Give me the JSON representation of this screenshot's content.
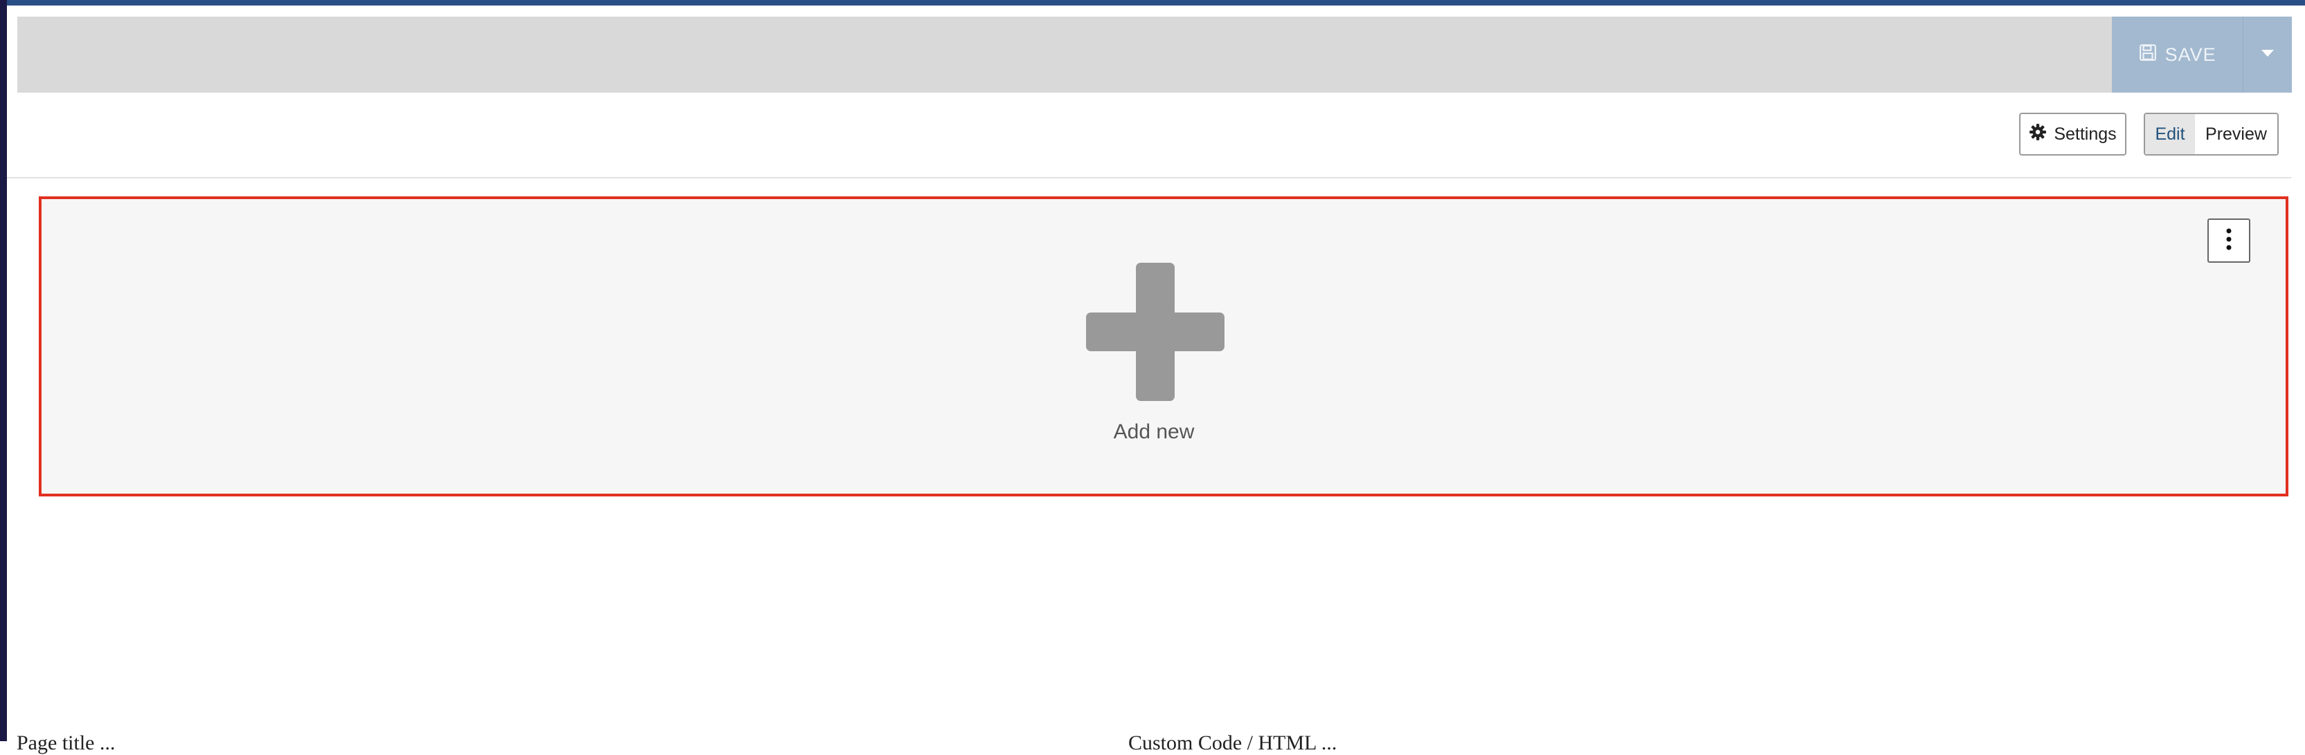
{
  "toolbar": {
    "save_label": "SAVE",
    "save_icon": "floppy-disk-icon",
    "dropdown_icon": "caret-down-icon"
  },
  "controls": {
    "settings_label": "Settings",
    "settings_icon": "gear-icon",
    "edit_label": "Edit",
    "preview_label": "Preview",
    "active_mode": "Edit"
  },
  "block": {
    "add_new_label": "Add new",
    "add_icon": "plus-icon",
    "menu_icon": "vertical-dots-icon"
  },
  "footer": {
    "left_text": "Page title ...",
    "right_text": "Custom Code / HTML ..."
  },
  "colors": {
    "accent": "#2a4f86",
    "save_bg": "#a3b9cf",
    "toolbar_bg": "#d9d9d9",
    "highlight_border": "#e0301e",
    "panel_bg": "#f6f6f6",
    "plus_color": "#999999"
  }
}
